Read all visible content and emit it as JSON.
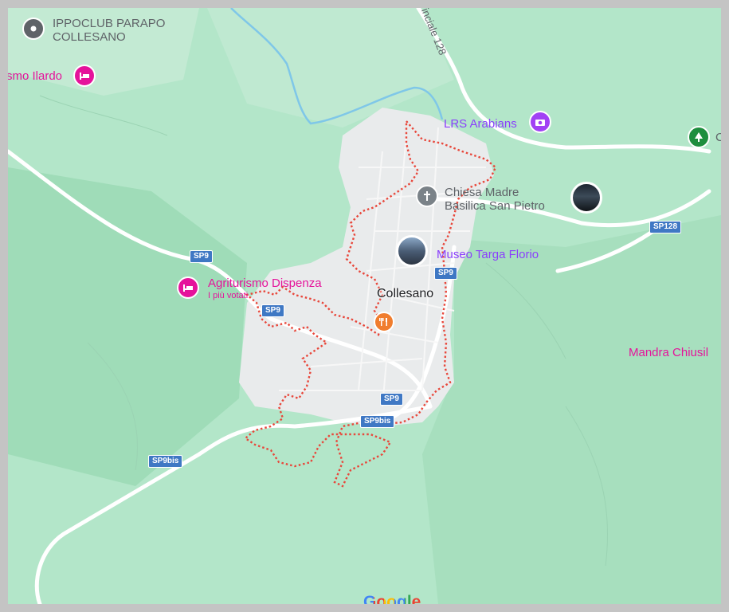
{
  "map": {
    "places": {
      "ippoclub_line1": "IPPOCLUB PARAPO",
      "ippoclub_line2": "COLLESANO",
      "ilardo": "smo Ilardo",
      "lrs": "LRS Arabians",
      "chiesa_line1": "Chiesa Madre",
      "chiesa_line2": "Basilica San Pietro",
      "museo": "Museo Targa Florio",
      "collesano": "Collesano",
      "agriturismo": "Agriturismo Dispenza",
      "agriturismo_sub": "I più votati",
      "mandra": "Mandra Chiusil",
      "park_partial": "C"
    },
    "road_shields": {
      "sp9_a": "SP9",
      "sp9_b": "SP9",
      "sp9_c": "SP9",
      "sp9_d": "SP9",
      "sp9bis_a": "SP9bis",
      "sp9bis_b": "SP9bis",
      "sp128": "SP128"
    },
    "road_label": "inciale 128",
    "logo": "Google",
    "colors": {
      "boundary": "#e8473b",
      "shield": "#3f78c4",
      "purple_poi": "#8a3ffc",
      "pink_poi": "#e5139b",
      "restaurant": "#f07d2e",
      "park": "#1e8e3e"
    },
    "icons": [
      "place-pin-icon",
      "hotel-icon",
      "camera-icon",
      "church-cross-icon",
      "restaurant-icon",
      "tree-icon",
      "photo-thumbnail"
    ]
  }
}
